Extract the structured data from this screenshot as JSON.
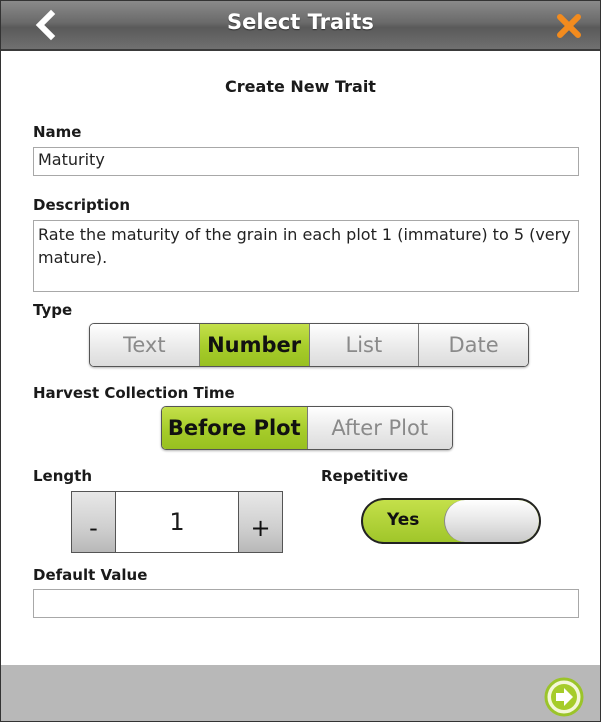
{
  "header": {
    "title": "Select Traits",
    "back_icon": "chevron-left-icon",
    "close_icon": "close-x-icon",
    "close_color": "#f28b1e"
  },
  "form": {
    "heading": "Create New Trait",
    "name": {
      "label": "Name",
      "value": "Maturity"
    },
    "description": {
      "label": "Description",
      "value": "Rate the maturity of the grain in each plot 1 (immature) to 5 (very mature)."
    },
    "type": {
      "label": "Type",
      "options": [
        "Text",
        "Number",
        "List",
        "Date"
      ],
      "selected": "Number"
    },
    "harvest": {
      "label": "Harvest Collection Time",
      "options": [
        "Before Plot",
        "After Plot"
      ],
      "selected": "Before Plot"
    },
    "length": {
      "label": "Length",
      "minus": "-",
      "value": "1",
      "plus": "+"
    },
    "repetitive": {
      "label": "Repetitive",
      "state_label": "Yes",
      "on": true
    },
    "default_value": {
      "label": "Default Value",
      "value": ""
    }
  },
  "footer": {
    "next_icon": "next-arrow-icon"
  },
  "colors": {
    "accent": "#a6cc2a",
    "footer_bg": "#b8b8b8"
  }
}
